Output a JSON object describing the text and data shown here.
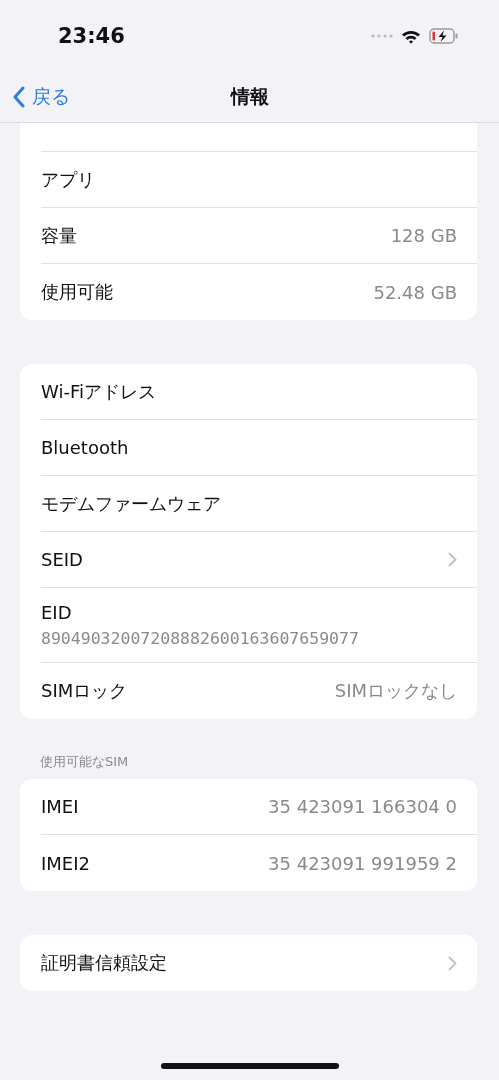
{
  "status_bar": {
    "time": "23:46"
  },
  "nav": {
    "back": "戻る",
    "title": "情報"
  },
  "sections": [
    {
      "rows": [
        {
          "kind": "value",
          "label": "アプリ"
        },
        {
          "kind": "value",
          "label": "容量",
          "value": "128 GB"
        },
        {
          "kind": "value",
          "label": "使用可能",
          "value": "52.48 GB"
        }
      ]
    },
    {
      "rows": [
        {
          "kind": "value",
          "label": "Wi-Fiアドレス"
        },
        {
          "kind": "value",
          "label": "Bluetooth"
        },
        {
          "kind": "value",
          "label": "モデムファームウェア"
        },
        {
          "kind": "chevron",
          "label": "SEID"
        },
        {
          "kind": "stacked",
          "label": "EID",
          "value": "89049032007208882600163607659077"
        },
        {
          "kind": "value",
          "label": "SIMロック",
          "value": "SIMロックなし"
        }
      ]
    },
    {
      "header": "使用可能なSIM",
      "rows": [
        {
          "kind": "value",
          "label": "IMEI",
          "value": "35 423091 166304 0"
        },
        {
          "kind": "value",
          "label": "IMEI2",
          "value": "35 423091 991959 2"
        }
      ]
    },
    {
      "rows": [
        {
          "kind": "chevron",
          "label": "証明書信頼設定"
        }
      ]
    }
  ]
}
